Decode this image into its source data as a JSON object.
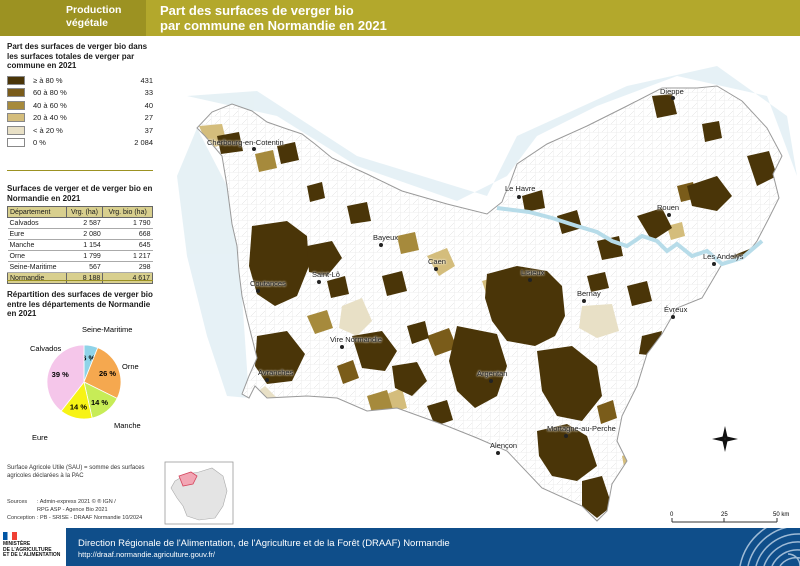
{
  "header": {
    "category_line1": "Production",
    "category_line2": "végétale",
    "title_line1": "Part des surfaces de verger bio",
    "title_line2": "par commune en Normandie en 2021"
  },
  "legend": {
    "title": "Part des surfaces de verger bio dans les surfaces totales de verger par commune en 2021",
    "classes": [
      {
        "label": "≥ à 80 %",
        "count": "431",
        "color": "#4a3508"
      },
      {
        "label": "60 à 80 %",
        "count": "33",
        "color": "#7a5c1a"
      },
      {
        "label": "40 à 60 %",
        "count": "40",
        "color": "#a68a3c"
      },
      {
        "label": "20 à 40 %",
        "count": "27",
        "color": "#d4bd7c"
      },
      {
        "label": "< à 20 %",
        "count": "37",
        "color": "#e8e0c6"
      },
      {
        "label": "0 %",
        "count": "2 084",
        "color": "#ffffff"
      }
    ]
  },
  "surfaces_table": {
    "title": "Surfaces de verger et de verger bio en Normandie en 2021",
    "headers": [
      "Département",
      "Vrg. (ha)",
      "Vrg. bio (ha)"
    ],
    "rows": [
      [
        "Calvados",
        "2 587",
        "1 790"
      ],
      [
        "Eure",
        "2 080",
        "668"
      ],
      [
        "Manche",
        "1 154",
        "645"
      ],
      [
        "Orne",
        "1 799",
        "1 217"
      ],
      [
        "Seine-Maritime",
        "567",
        "298"
      ]
    ],
    "total": [
      "Normandie",
      "8 188",
      "4 617"
    ]
  },
  "chart_data": {
    "type": "pie",
    "title": "Répartition des surfaces de verger bio entre les départements de Normandie en 2021",
    "slices": [
      {
        "name": "Seine-Maritime",
        "value": 6,
        "label": "6 %",
        "color": "#8fd3e8"
      },
      {
        "name": "Orne",
        "value": 26,
        "label": "26 %",
        "color": "#f5a84f"
      },
      {
        "name": "Manche",
        "value": 14,
        "label": "14 %",
        "color": "#c7ec57"
      },
      {
        "name": "Eure",
        "value": 14,
        "label": "14 %",
        "color": "#f7f315"
      },
      {
        "name": "Calvados",
        "value": 39,
        "label": "39 %",
        "color": "#f5c6ea"
      }
    ]
  },
  "note": "Surface Agricole Utile (SAU) = somme des surfaces agricoles déclarées à la PAC",
  "sources": {
    "label": "Sources",
    "line1": ": Admin-express 2021 © ® IGN /",
    "line2": "RPG ASP - Agence Bio 2021",
    "conception_label": "Conception",
    "conception": ": PB - SRISE - DRAAF Normandie 10/2024"
  },
  "map": {
    "towns": [
      "Dieppe",
      "Cherbourg-en-Cotentin",
      "Le Havre",
      "Rouen",
      "Bayeux",
      "Caen",
      "Lisieux",
      "Saint-Lô",
      "Les Andelys",
      "Coutances",
      "Bernay",
      "Évreux",
      "Vire Normandie",
      "Avranches",
      "Argentan",
      "Mortagne-au-Perche",
      "Alençon"
    ],
    "scale_labels": [
      "0",
      "25",
      "50 km"
    ]
  },
  "footer": {
    "organization": "Direction Régionale de l'Alimentation, de l'Agriculture et de la Forêt (DRAAF) Normandie",
    "url": "http://draaf.normandie.agriculture.gouv.fr/",
    "ministry_line1": "MINISTÈRE",
    "ministry_line2": "DE L'AGRICULTURE",
    "ministry_line3": "ET DE L'ALIMENTATION"
  }
}
